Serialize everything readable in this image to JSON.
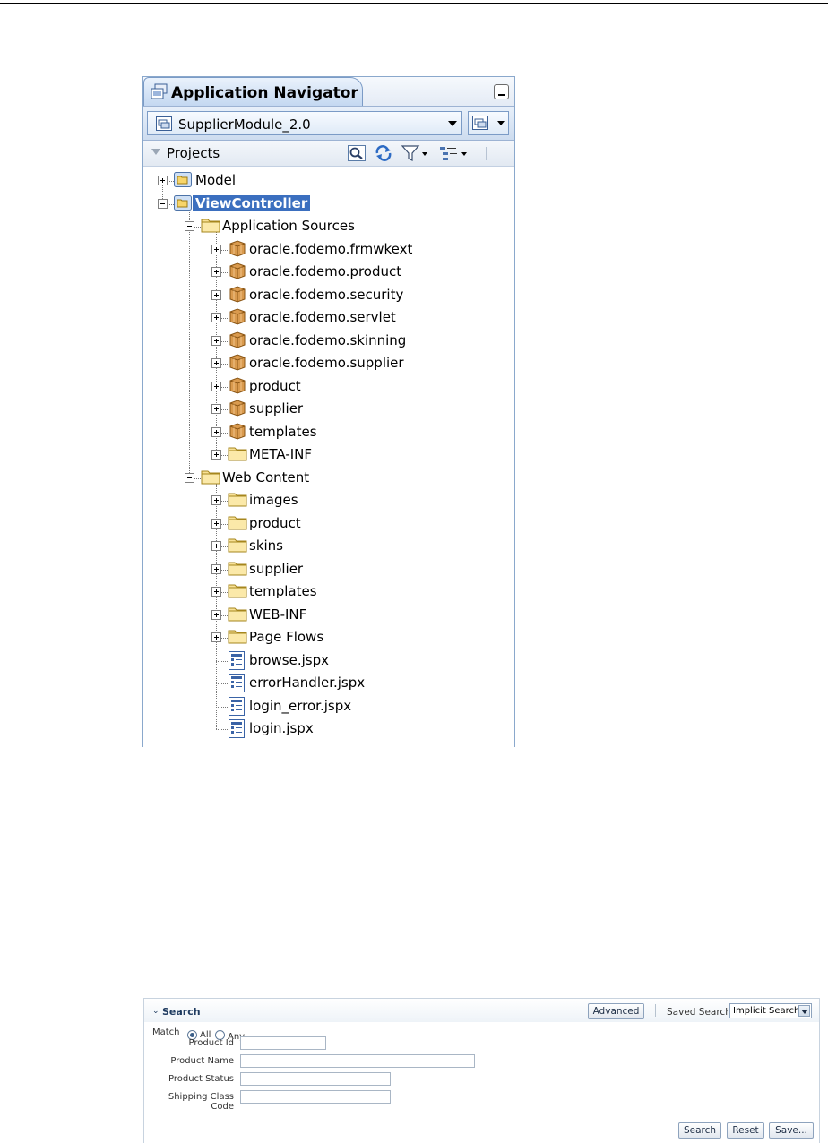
{
  "navigator": {
    "title": "Application Navigator",
    "module": "SupplierModule_2.0",
    "projects_label": "Projects"
  },
  "tree": [
    {
      "label": "Model",
      "level": 0,
      "toggle": "plus",
      "icon": "project-folder-icon"
    },
    {
      "label": "ViewController",
      "level": 0,
      "toggle": "minus",
      "icon": "project-folder-icon",
      "selected": true
    },
    {
      "label": "Application Sources",
      "level": 1,
      "toggle": "minus",
      "icon": "folder-icon"
    },
    {
      "label": "oracle.fodemo.frmwkext",
      "level": 2,
      "toggle": "plus",
      "icon": "package-icon"
    },
    {
      "label": "oracle.fodemo.product",
      "level": 2,
      "toggle": "plus",
      "icon": "package-icon"
    },
    {
      "label": "oracle.fodemo.security",
      "level": 2,
      "toggle": "plus",
      "icon": "package-icon"
    },
    {
      "label": "oracle.fodemo.servlet",
      "level": 2,
      "toggle": "plus",
      "icon": "package-icon"
    },
    {
      "label": "oracle.fodemo.skinning",
      "level": 2,
      "toggle": "plus",
      "icon": "package-icon"
    },
    {
      "label": "oracle.fodemo.supplier",
      "level": 2,
      "toggle": "plus",
      "icon": "package-icon"
    },
    {
      "label": "product",
      "level": 2,
      "toggle": "plus",
      "icon": "package-icon"
    },
    {
      "label": "supplier",
      "level": 2,
      "toggle": "plus",
      "icon": "package-icon"
    },
    {
      "label": "templates",
      "level": 2,
      "toggle": "plus",
      "icon": "package-icon"
    },
    {
      "label": "META-INF",
      "level": 2,
      "toggle": "plus",
      "icon": "folder-icon"
    },
    {
      "label": "Web Content",
      "level": 1,
      "toggle": "minus",
      "icon": "folder-icon"
    },
    {
      "label": "images",
      "level": 2,
      "toggle": "plus",
      "icon": "folder-icon"
    },
    {
      "label": "product",
      "level": 2,
      "toggle": "plus",
      "icon": "folder-icon"
    },
    {
      "label": "skins",
      "level": 2,
      "toggle": "plus",
      "icon": "folder-icon"
    },
    {
      "label": "supplier",
      "level": 2,
      "toggle": "plus",
      "icon": "folder-icon"
    },
    {
      "label": "templates",
      "level": 2,
      "toggle": "plus",
      "icon": "folder-icon"
    },
    {
      "label": "WEB-INF",
      "level": 2,
      "toggle": "plus",
      "icon": "folder-icon"
    },
    {
      "label": "Page Flows",
      "level": 2,
      "toggle": "plus",
      "icon": "folder-icon"
    },
    {
      "label": "browse.jspx",
      "level": 2,
      "toggle": "none",
      "icon": "jspx-file-icon"
    },
    {
      "label": "errorHandler.jspx",
      "level": 2,
      "toggle": "none",
      "icon": "jspx-file-icon"
    },
    {
      "label": "login_error.jspx",
      "level": 2,
      "toggle": "none",
      "icon": "jspx-file-icon"
    },
    {
      "label": "login.jspx",
      "level": 2,
      "toggle": "none",
      "icon": "jspx-file-icon"
    }
  ],
  "search": {
    "title": "Search",
    "advanced_label": "Advanced",
    "saved_search_label": "Saved Search",
    "saved_search_value": "Implicit Search",
    "match_label": "Match",
    "match_all": "All",
    "match_any": "Any",
    "fields": [
      {
        "label": "Product Id"
      },
      {
        "label": "Product Name"
      },
      {
        "label": "Product Status"
      },
      {
        "label": "Shipping Class Code"
      }
    ],
    "search_button": "Search",
    "reset_button": "Reset",
    "save_button": "Save..."
  },
  "colors": {
    "selection": "#3b6fbf",
    "panel_border": "#8aa8cc",
    "search_title": "#1f3b60"
  }
}
